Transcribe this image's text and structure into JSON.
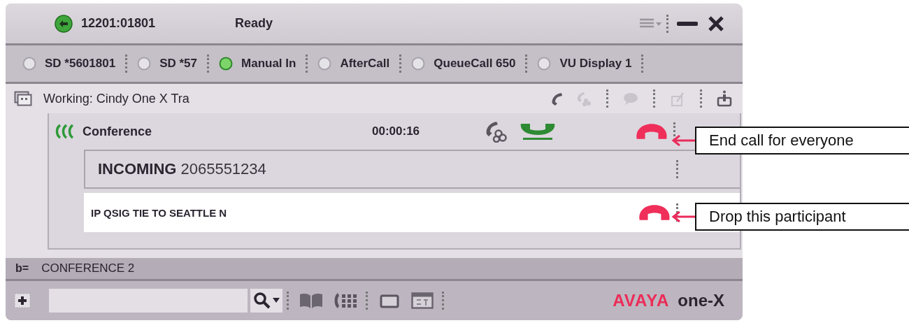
{
  "window": {
    "extension": "12201:01801",
    "status": "Ready",
    "online": true
  },
  "features": [
    {
      "label": "SD *5601801",
      "lit": false
    },
    {
      "label": "SD *57",
      "lit": false
    },
    {
      "label": "Manual In",
      "lit": true
    },
    {
      "label": "AfterCall",
      "lit": false
    },
    {
      "label": "QueueCall 650",
      "lit": false
    },
    {
      "label": "VU Display 1",
      "lit": false
    }
  ],
  "work_item": {
    "label": "Working: Cindy One X Tra",
    "actions": [
      {
        "kind": "handset",
        "disabled": false
      },
      {
        "kind": "conference",
        "disabled": true
      },
      {
        "kind": "chat",
        "disabled": true
      },
      {
        "kind": "pin",
        "disabled": true
      },
      {
        "kind": "info",
        "disabled": false
      }
    ]
  },
  "call": {
    "title": "Conference",
    "timer": "00:00:16",
    "note": "End call for everyone",
    "participants": [
      {
        "label": "INCOMING",
        "number": "2065551234",
        "selected": false
      },
      {
        "label": "IP QSIG TIE TO SEATTLE N",
        "selected": true,
        "note": "Drop this participant"
      }
    ]
  },
  "line": {
    "prefix": "b=",
    "label": "CONFERENCE 2"
  },
  "logo": {
    "brand": "AVAYA",
    "product": "one-X"
  }
}
